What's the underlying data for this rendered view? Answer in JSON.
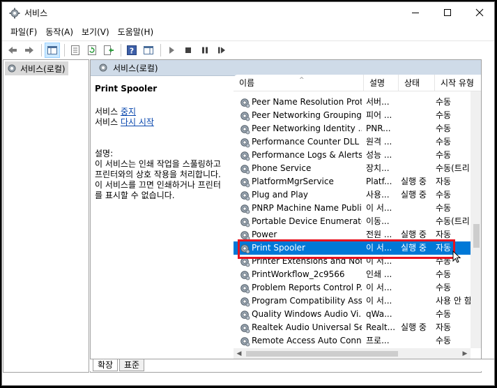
{
  "window": {
    "title": "서비스"
  },
  "menu": [
    "파일(F)",
    "동작(A)",
    "보기(V)",
    "도움말(H)"
  ],
  "tree": {
    "root_label": "서비스(로컬)"
  },
  "panel": {
    "header": "서비스(로컬)"
  },
  "details": {
    "name": "Print Spooler",
    "action_stop_prefix": "서비스 ",
    "action_stop_link": "중지",
    "action_restart_prefix": "서비스 ",
    "action_restart_link": "다시 시작",
    "desc_label": "설명:",
    "desc_lines": [
      "이 서비스는 인쇄 작업을 스풀링하고",
      "프린터와의 상호 작용을 처리합니다.",
      "이 서비스를 끄면 인쇄하거나 프린터",
      "를 표시할 수 없습니다."
    ]
  },
  "columns": {
    "name": "이름",
    "desc": "설명",
    "state": "상태",
    "start": "시작 유형"
  },
  "rows": [
    {
      "name": "Peer Name Resolution Prot...",
      "desc": "서버...",
      "state": "",
      "start": "수동"
    },
    {
      "name": "Peer Networking Grouping",
      "desc": "피어 ...",
      "state": "",
      "start": "수동"
    },
    {
      "name": "Peer Networking Identity ...",
      "desc": "PNR...",
      "state": "",
      "start": "수동"
    },
    {
      "name": "Performance Counter DLL ...",
      "desc": "원격 ...",
      "state": "",
      "start": "수동"
    },
    {
      "name": "Performance Logs & Alerts",
      "desc": "성능 ...",
      "state": "",
      "start": "수동"
    },
    {
      "name": "Phone Service",
      "desc": "장치...",
      "state": "",
      "start": "수동(트리..."
    },
    {
      "name": "PlatformMgrService",
      "desc": "Platf...",
      "state": "실행 중",
      "start": "자동"
    },
    {
      "name": "Plug and Play",
      "desc": "사용...",
      "state": "실행 중",
      "start": "수동"
    },
    {
      "name": "PNRP Machine Name Publi...",
      "desc": "이 서...",
      "state": "",
      "start": "수동"
    },
    {
      "name": "Portable Device Enumerato...",
      "desc": "이동...",
      "state": "",
      "start": "수동(트리..."
    },
    {
      "name": "Power",
      "desc": "전원 ...",
      "state": "실행 중",
      "start": "자동"
    },
    {
      "name": "Print Spooler",
      "desc": "이 서...",
      "state": "실행 중",
      "start": "자동",
      "selected": true
    },
    {
      "name": "Printer Extensions and Noti...",
      "desc": "이 서...",
      "state": "",
      "start": "수동"
    },
    {
      "name": "PrintWorkflow_2c9566",
      "desc": "인쇄 ...",
      "state": "",
      "start": "수동"
    },
    {
      "name": "Problem Reports Control P...",
      "desc": "이 서...",
      "state": "",
      "start": "수동"
    },
    {
      "name": "Program Compatibility Assi...",
      "desc": "이 서...",
      "state": "",
      "start": "사용 안 함"
    },
    {
      "name": "Quality Windows Audio Vi...",
      "desc": "qWa...",
      "state": "",
      "start": "수동"
    },
    {
      "name": "Realtek Audio Universal Ser...",
      "desc": "Realt...",
      "state": "실행 중",
      "start": "자동"
    },
    {
      "name": "Remote Access Auto Conn...",
      "desc": "프로...",
      "state": "",
      "start": "수동"
    }
  ],
  "tabs": {
    "extended": "확장",
    "standard": "표준"
  }
}
